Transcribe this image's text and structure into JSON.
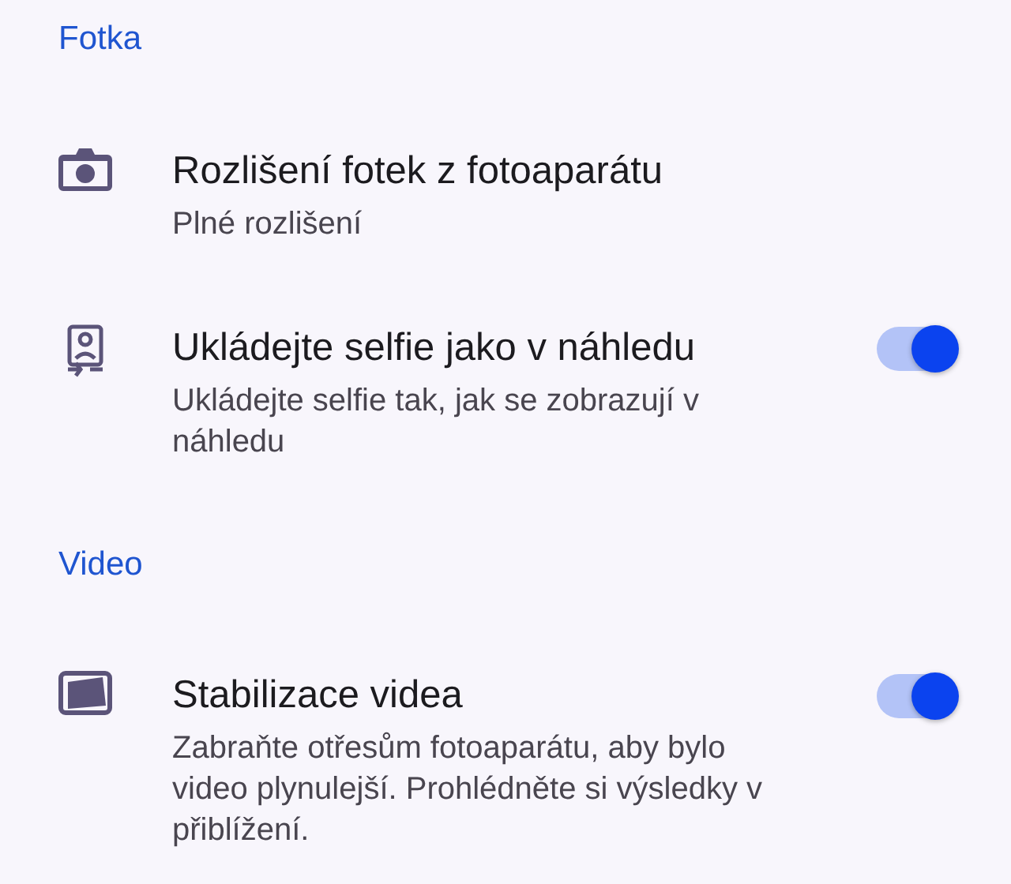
{
  "sections": [
    {
      "header": "Fotka",
      "items": [
        {
          "kind": "plain",
          "title": "Rozlišení fotek z fotoaparátu",
          "subtitle": "Plné rozlišení"
        },
        {
          "kind": "toggle",
          "title": "Ukládejte selfie jako v náhledu",
          "subtitle": "Ukládejte selfie tak, jak se zobrazují v náhledu",
          "on": true
        }
      ]
    },
    {
      "header": "Video",
      "items": [
        {
          "kind": "toggle",
          "title": "Stabilizace videa",
          "subtitle": "Zabraňte otřesům fotoaparátu, aby bylo video plynulejší. Prohlédněte si výsledky v přiblížení.",
          "on": true
        }
      ]
    }
  ]
}
